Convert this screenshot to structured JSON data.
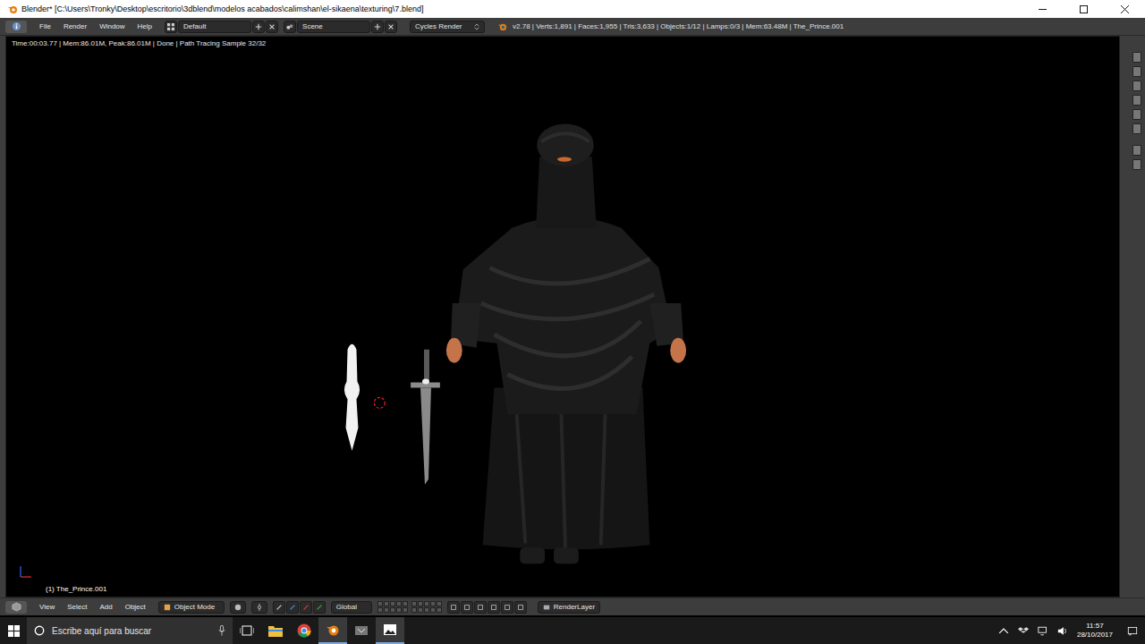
{
  "window": {
    "title": "Blender* [C:\\Users\\Tronky\\Desktop\\escritorio\\3dblend\\modelos acabados\\calimshan\\el-sikaena\\texturing\\7.blend]"
  },
  "info_header": {
    "menus": [
      "File",
      "Render",
      "Window",
      "Help"
    ],
    "layout": "Default",
    "scene": "Scene",
    "engine": "Cycles Render",
    "stats": "v2.78 | Verts:1,891 | Faces:1,955 | Tris:3,633 | Objects:1/12 | Lamps:0/3 | Mem:63.48M | The_Prince.001"
  },
  "viewport": {
    "render_info": "Time:00:03.77 | Mem:86.01M, Peak:86.01M | Done | Path Tracing Sample 32/32",
    "object_label": "(1) The_Prince.001"
  },
  "view_header": {
    "menus": [
      "View",
      "Select",
      "Add",
      "Object"
    ],
    "mode": "Object Mode",
    "orientation": "Global",
    "render_layer": "RenderLayer"
  },
  "taskbar": {
    "search_placeholder": "Escribe aquí para buscar",
    "apps": [
      {
        "kind": "explorer",
        "active": false
      },
      {
        "kind": "chrome",
        "active": false
      },
      {
        "kind": "blender",
        "active": true
      },
      {
        "kind": "game",
        "active": false
      },
      {
        "kind": "photos",
        "active": true
      }
    ],
    "time": "11:57",
    "date": "28/10/2017"
  }
}
